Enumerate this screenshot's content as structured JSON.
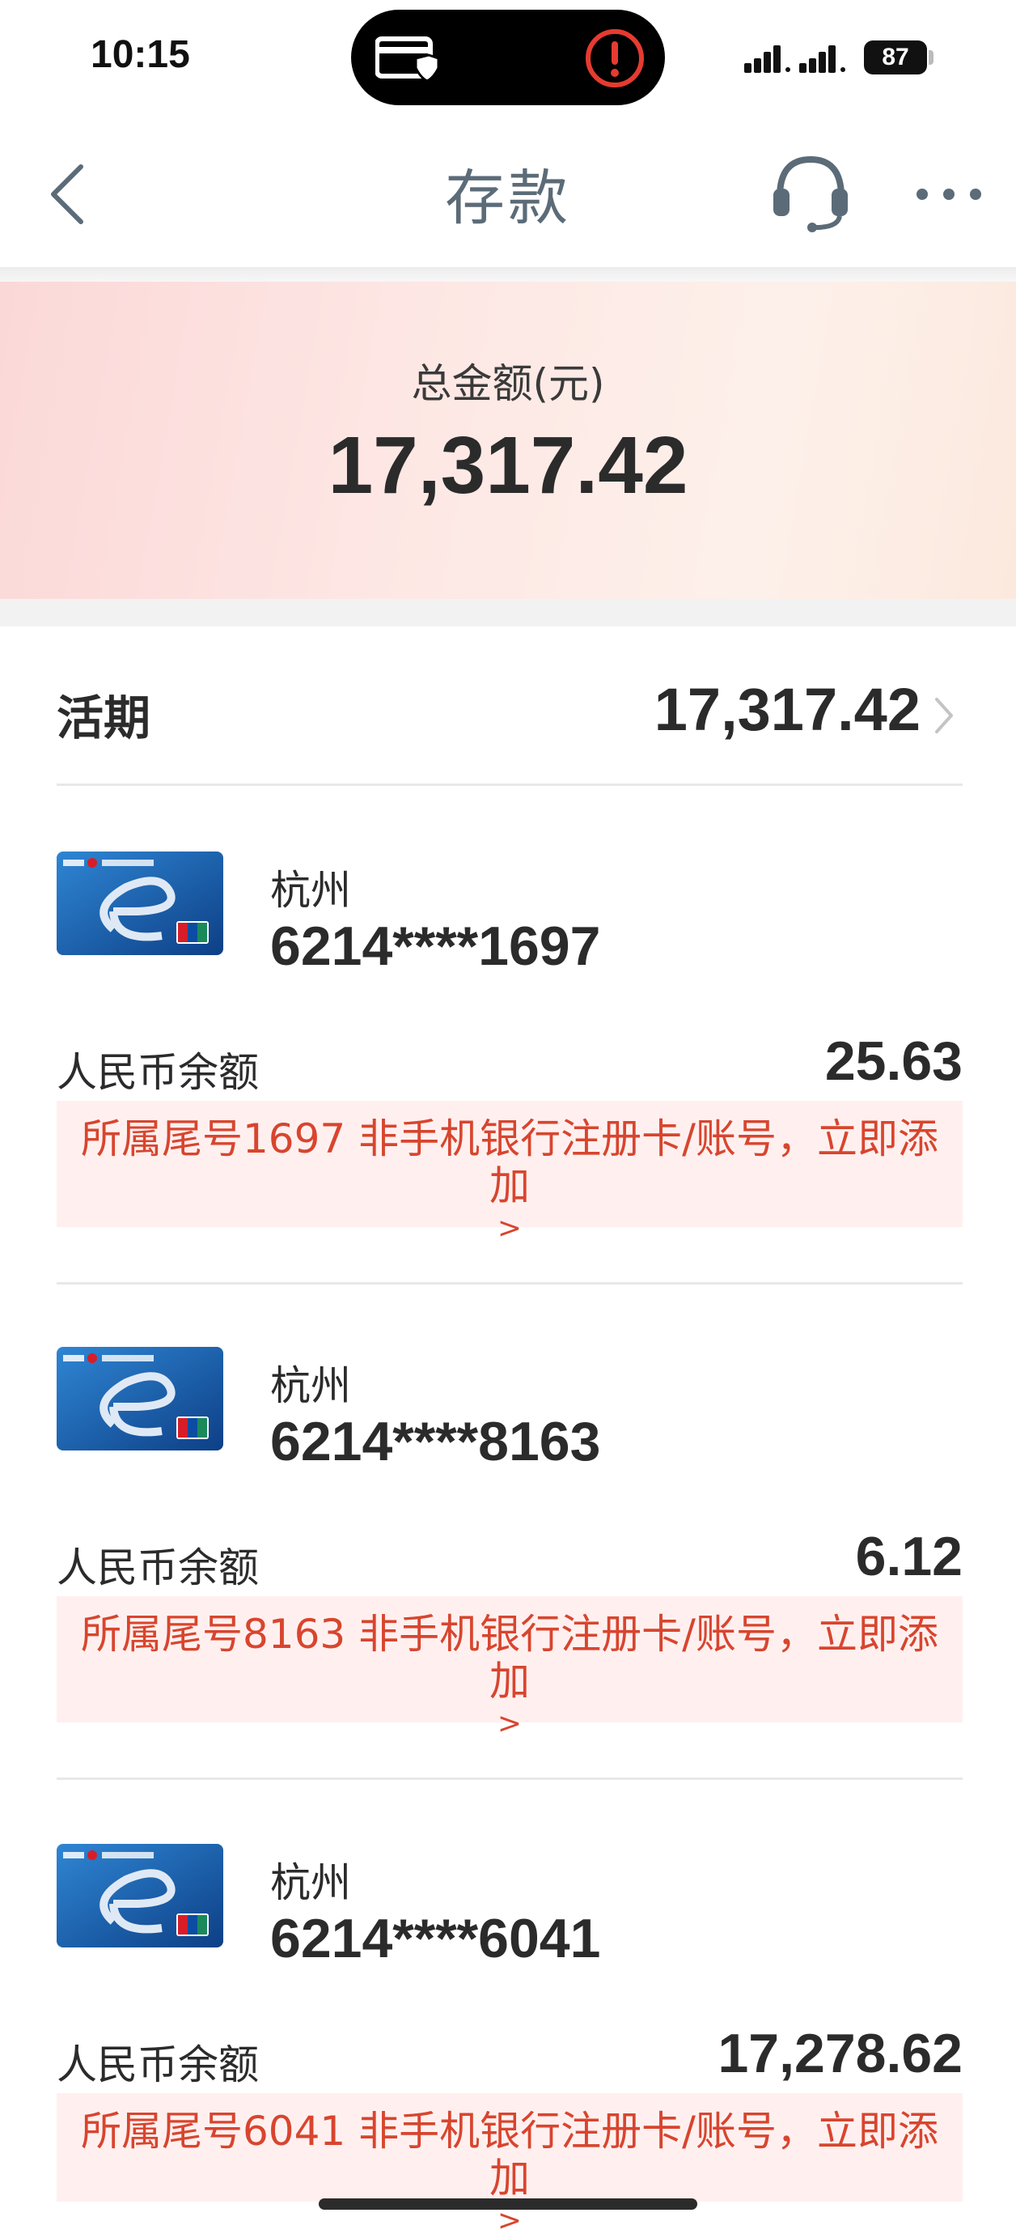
{
  "status_bar": {
    "time": "10:15",
    "battery": "87",
    "icons": [
      "card-shield-icon",
      "alert-icon",
      "signal-icon",
      "battery-icon"
    ]
  },
  "nav": {
    "title": "存款",
    "icons": [
      "back-icon",
      "customer-service-icon",
      "more-icon"
    ]
  },
  "summary": {
    "label": "总金额(元)",
    "amount": "17,317.42"
  },
  "demand": {
    "title": "活期",
    "total": "17,317.42"
  },
  "accounts": [
    {
      "city": "杭州",
      "number": "6214****1697",
      "balance_label": "人民币余额",
      "balance": "25.63",
      "notice": "所属尾号1697 非手机银行注册卡/账号，立即添加",
      "notice_arrow": ">"
    },
    {
      "city": "杭州",
      "number": "6214****8163",
      "balance_label": "人民币余额",
      "balance": "6.12",
      "notice": "所属尾号8163 非手机银行注册卡/账号，立即添加",
      "notice_arrow": ">"
    },
    {
      "city": "杭州",
      "number": "6214****6041",
      "balance_label": "人民币余额",
      "balance": "17,278.62",
      "notice": "所属尾号6041 非手机银行注册卡/账号，立即添加",
      "notice_arrow": ">"
    }
  ],
  "colors": {
    "notice_text": "#d8452e",
    "notice_bg": "#fff0ef",
    "nav_title": "#5b6b78",
    "card_blue": "#1b5fae"
  }
}
